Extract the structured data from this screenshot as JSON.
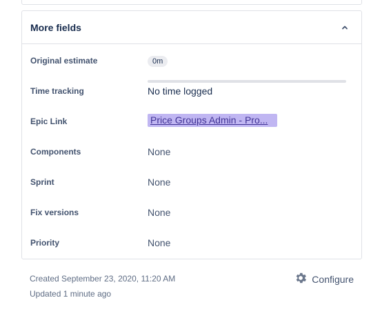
{
  "panel": {
    "title": "More fields",
    "rows": [
      {
        "label": "Original estimate",
        "value": "0m"
      },
      {
        "label": "Time tracking",
        "value": "No time logged",
        "progress": 0
      },
      {
        "label": "Epic Link",
        "value": "Price Groups Admin - Pro..."
      },
      {
        "label": "Components",
        "value": "None"
      },
      {
        "label": "Sprint",
        "value": "None"
      },
      {
        "label": "Fix versions",
        "value": "None"
      },
      {
        "label": "Priority",
        "value": "None"
      }
    ]
  },
  "footer": {
    "created": "Created September 23, 2020, 11:20 AM",
    "updated": "Updated 1 minute ago",
    "configure_label": "Configure"
  },
  "colors": {
    "epic": "#c0b6f2",
    "border": "#dfe1e6"
  }
}
